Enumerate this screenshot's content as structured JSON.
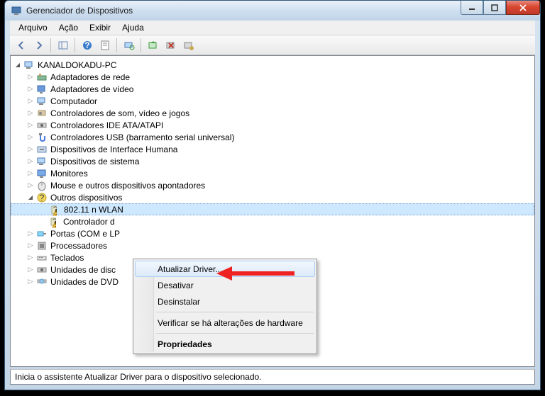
{
  "window": {
    "title": "Gerenciador de Dispositivos"
  },
  "menu": {
    "file": "Arquivo",
    "action": "Ação",
    "view": "Exibir",
    "help": "Ajuda"
  },
  "tree": {
    "root": "KANALDOKADU-PC",
    "nodes": [
      "Adaptadores de rede",
      "Adaptadores de vídeo",
      "Computador",
      "Controladores de som, vídeo e jogos",
      "Controladores IDE ATA/ATAPI",
      "Controladores USB (barramento serial universal)",
      "Dispositivos de Interface Humana",
      "Dispositivos de sistema",
      "Monitores",
      "Mouse e outros dispositivos apontadores"
    ],
    "other_devices": "Outros dispositivos",
    "other_children": [
      "802.11 n WLAN",
      "Controlador d"
    ],
    "after": [
      "Portas (COM e LP",
      "Processadores",
      "Teclados",
      "Unidades de disc",
      "Unidades de DVD"
    ]
  },
  "context_menu": {
    "update": "Atualizar Driver...",
    "disable": "Desativar",
    "uninstall": "Desinstalar",
    "scan": "Verificar se há alterações de hardware",
    "properties": "Propriedades"
  },
  "statusbar": {
    "text": "Inicia o assistente Atualizar Driver para o dispositivo selecionado."
  }
}
